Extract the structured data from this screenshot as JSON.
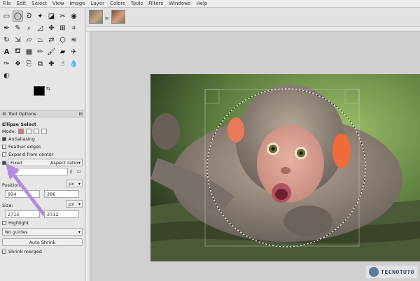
{
  "menu": [
    "File",
    "Edit",
    "Select",
    "View",
    "Image",
    "Layer",
    "Colors",
    "Tools",
    "Filters",
    "Windows",
    "Help"
  ],
  "tools": [
    "rect-select",
    "ellipse-select",
    "free-select",
    "fuzzy-select",
    "color-select",
    "scissors",
    "foreground-select",
    "paths",
    "color-picker",
    "zoom",
    "measure",
    "move",
    "align",
    "crop",
    "rotate",
    "scale",
    "shear",
    "perspective",
    "flip",
    "cage",
    "warp",
    "text",
    "bucket-fill",
    "blend",
    "pencil",
    "paintbrush",
    "eraser",
    "airbrush",
    "ink",
    "mypaint",
    "clone",
    "perspective-clone",
    "heal",
    "smudge",
    "blur",
    "dodge-burn"
  ],
  "tool_options": {
    "tab_label": "Tool Options",
    "title": "Ellipse Select",
    "mode_label": "Mode:",
    "antialiasing": "Antialiasing",
    "feather": "Feather edges",
    "expand": "Expand from center",
    "fixed_label": "Fixed",
    "fixed_value": "Aspect ratio",
    "ratio_value": "1:1",
    "position_label": "Position:",
    "pos_x": "924",
    "pos_y": "286",
    "pos_unit": "px",
    "size_label": "Size:",
    "size_w": "2712",
    "size_h": "2712",
    "size_unit": "px",
    "highlight": "Highlight",
    "guides": "No guides",
    "auto_shrink": "Auto Shrink",
    "shrink_merged": "Shrink merged"
  },
  "colors": {
    "foreground": "#000000",
    "background": "#f2a15a"
  },
  "watermark": {
    "text": "TECNOTUTO"
  }
}
